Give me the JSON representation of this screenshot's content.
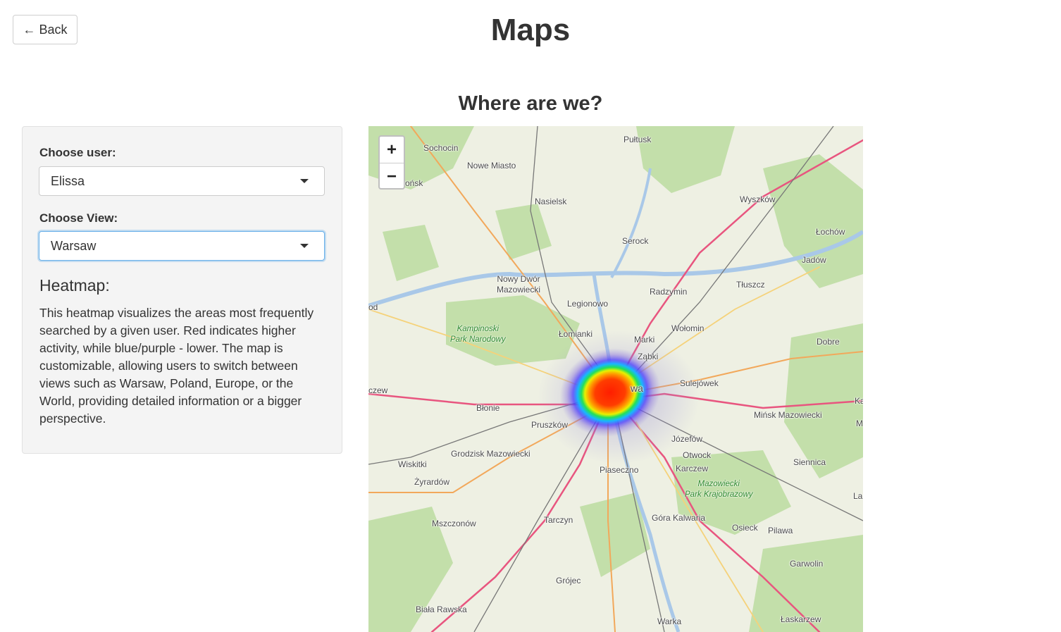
{
  "header": {
    "back_label": "← Back",
    "title": "Maps",
    "section_title": "Where are we?"
  },
  "sidebar": {
    "user_label": "Choose user:",
    "user_value": "Elissa",
    "view_label": "Choose View:",
    "view_value": "Warsaw",
    "heatmap_title": "Heatmap:",
    "heatmap_description": "This heatmap visualizes the areas most frequently searched by a given user. Red indicates higher activity, while blue/purple - lower. The map is customizable, allowing users to switch between views such as Warsaw, Poland, Europe, or the World, providing detailed information or a bigger perspective."
  },
  "map": {
    "zoom_in": "+",
    "zoom_out": "−",
    "places": {
      "sochocin": "Sochocin",
      "pultusk": "Pułtusk",
      "nowe_miasto": "Nowe Miasto",
      "plonsk": "ońsk",
      "nasielsk": "Nasielsk",
      "wyszkow": "Wyszków",
      "lochow": "Łochów",
      "serock": "Serock",
      "jadow": "Jadów",
      "nowy_dwor": "Nowy Dwór\nMazowiecki",
      "radzymin": "Radzymin",
      "tluszcz": "Tłuszcz",
      "legionowo": "Legionowo",
      "od": "od",
      "lomianki": "Łomianki",
      "marki": "Marki",
      "wolomin": "Wołomin",
      "dobre": "Dobre",
      "zabki": "Ząbki",
      "warszawa_frag": "wa",
      "sulejowek": "Sulejówek",
      "czew": "czew",
      "blonie": "Błonie",
      "minsk": "Mińsk Mazowiecki",
      "ka": "Ka",
      "m": "M",
      "pruszkow": "Pruszków",
      "jozefow": "Józefów",
      "grodzisk": "Grodzisk Mazowiecki",
      "otwock": "Otwock",
      "wiskitki": "Wiskitki",
      "piaseczno": "Piaseczno",
      "karczew": "Karczew",
      "siennica": "Siennica",
      "zyrardow": "Żyrardów",
      "la": "La",
      "mszczonow": "Mszczonów",
      "tarczyn": "Tarczyn",
      "gora_kalwaria": "Góra Kalwaria",
      "osieck": "Osieck",
      "pilawa": "Pilawa",
      "garwolin": "Garwolin",
      "grojec": "Grójec",
      "biala_rawska": "Biała Rawska",
      "warka": "Warka",
      "laskarzew": "Łaskarzew"
    },
    "parks": {
      "kampinoski": "Kampinoski\nPark Narodowy",
      "mazowiecki": "Mazowiecki\nPark Krajobrazowy"
    }
  },
  "colors": {
    "accent_focus": "#66afe9",
    "heat_high": "#ff2a00",
    "heat_low": "#6a5acd",
    "forest": "#b8d8a4",
    "motorway": "#e8557f"
  }
}
